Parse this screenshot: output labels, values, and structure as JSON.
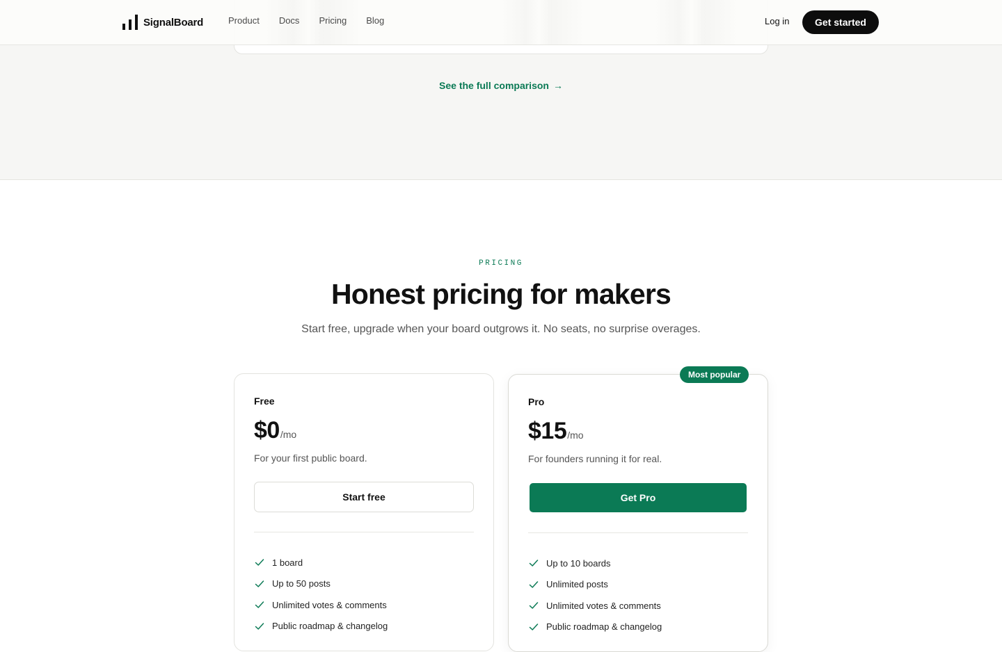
{
  "nav": {
    "brand": "SignalBoard",
    "links": [
      "Product",
      "Docs",
      "Pricing",
      "Blog"
    ],
    "login": "Log in",
    "cta": "Get started"
  },
  "comparison": {
    "link": "See the full comparison",
    "arrow": "→"
  },
  "pricing": {
    "eyebrow": "PRICING",
    "headline": "Honest pricing for makers",
    "subhead": "Start free, upgrade when your board outgrows it. No seats, no surprise overages."
  },
  "plans": {
    "free": {
      "name": "Free",
      "price": "$0",
      "per": "/mo",
      "tagline": "For your first public board.",
      "button": "Start free",
      "features": [
        "1 board",
        "Up to 50 posts",
        "Unlimited votes & comments",
        "Public roadmap & changelog"
      ]
    },
    "pro": {
      "badge": "Most popular",
      "name": "Pro",
      "price": "$15",
      "per": "/mo",
      "tagline": "For founders running it for real.",
      "button": "Get Pro",
      "features": [
        "Up to 10 boards",
        "Unlimited posts",
        "Unlimited votes & comments",
        "Public roadmap & changelog"
      ]
    }
  },
  "colors": {
    "accent": "#0b7a55",
    "dark": "#0d0d0d",
    "section_bg": "#f6f6f4"
  },
  "icons": {
    "brand": "bar-chart-icon",
    "feature": "check-icon",
    "link_arrow": "arrow-right-icon"
  }
}
